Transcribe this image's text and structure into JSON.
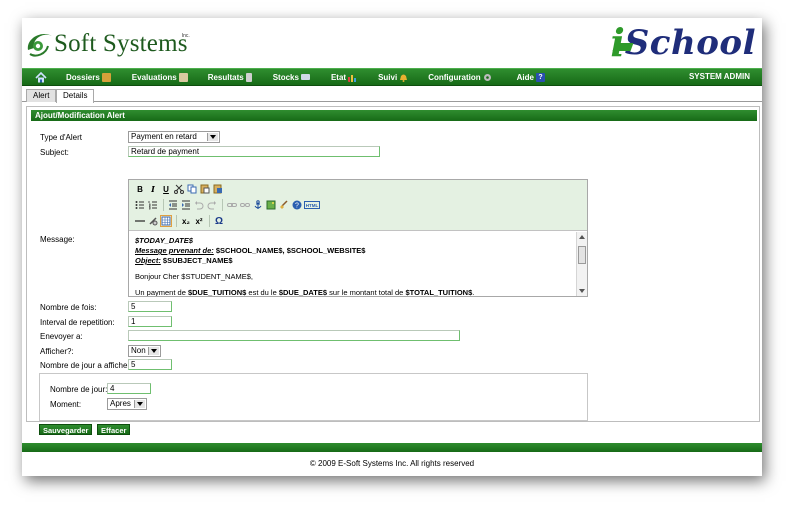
{
  "brand": {
    "company_name": "Soft Systems",
    "company_suffix": "Inc.",
    "product_first": "i",
    "product_rest": "School"
  },
  "nav": {
    "items": [
      {
        "label": "Dossiers",
        "icon": "folder-people-icon",
        "color": "#d6a13a"
      },
      {
        "label": "Evaluations",
        "icon": "edit-paper-icon",
        "color": "#d9c9a0"
      },
      {
        "label": "Resultats",
        "icon": "report-icon",
        "color": "#d0d0d0"
      },
      {
        "label": "Stocks",
        "icon": "mail-icon",
        "color": "#cfd8e6"
      },
      {
        "label": "Etat",
        "icon": "bar-chart-icon",
        "color": "#d44"
      },
      {
        "label": "Suivi",
        "icon": "bell-icon",
        "color": "#e8b030"
      },
      {
        "label": "Configuration",
        "icon": "gear-icon",
        "color": "#bcbcbc"
      },
      {
        "label": "Aide",
        "icon": "help-icon",
        "color": "#2a4fb0"
      }
    ],
    "user": "SYSTEM ADMIN"
  },
  "tabs": [
    {
      "label": "Alert",
      "active": false
    },
    {
      "label": "Details",
      "active": true
    }
  ],
  "form": {
    "title": "Ajout/Modification Alert",
    "type_label": "Type d'Alert",
    "type_value": "Payment en retard",
    "subject_label": "Subject:",
    "subject_value": "Retard de payment",
    "message_label": "Message:",
    "message": {
      "line1": "$TODAY_DATE$",
      "line2_label": "Message prvenant de:",
      "line2_value": " $SCHOOL_NAME$, $SCHOOL_WEBSITE$",
      "line3_label": "Object:",
      "line3_value": " $SUBJECT_NAME$",
      "line4": "Bonjour Cher $STUDENT_NAME$,",
      "line5_a": "Un payment de ",
      "line5_b": "$DUE_TUITION$",
      "line5_c": " est du le ",
      "line5_d": "$DUE_DATE$",
      "line5_e": " sur le montant total de ",
      "line5_f": "$TOTAL_TUITION$",
      "line5_g": "."
    },
    "nombre_fois_label": "Nombre de fois:",
    "nombre_fois_value": "5",
    "interval_label": "Interval de repetition:",
    "interval_value": "1",
    "envoyer_label": "Enevoyer a:",
    "envoyer_value": "",
    "afficher_label": "Afficher?:",
    "afficher_value": "Non",
    "nombre_jour_afficher_label": "Nombre de jour a afficher:",
    "nombre_jour_afficher_value": "5",
    "nombre_jour_label": "Nombre de jour:",
    "nombre_jour_value": "4",
    "moment_label": "Moment:",
    "moment_value": "Apres",
    "save_label": "Sauvegarder",
    "clear_label": "Effacer"
  },
  "toolbar": {
    "row1": [
      "bold-icon",
      "italic-icon",
      "underline-icon",
      "cut-icon",
      "copy-icon",
      "paste-icon",
      "paste-word-icon"
    ],
    "row2": [
      "bullet-list-icon",
      "numbered-list-icon",
      "outdent-icon",
      "indent-icon",
      "undo-icon",
      "redo-icon",
      "link-icon",
      "unlink-icon",
      "anchor-icon",
      "image-icon",
      "cleanup-icon",
      "help-icon",
      "html-icon"
    ],
    "row3": [
      "horizontal-rule-icon",
      "remove-format-icon",
      "table-icon",
      "subscript-icon",
      "superscript-icon",
      "omega-icon"
    ],
    "bold": "B",
    "italic": "I",
    "underline": "U",
    "html": "HTML",
    "sub": "x₂",
    "sup": "x²",
    "omega": "Ω"
  },
  "footer": {
    "copyright": "© 2009 E-Soft Systems Inc. All rights reserved"
  }
}
